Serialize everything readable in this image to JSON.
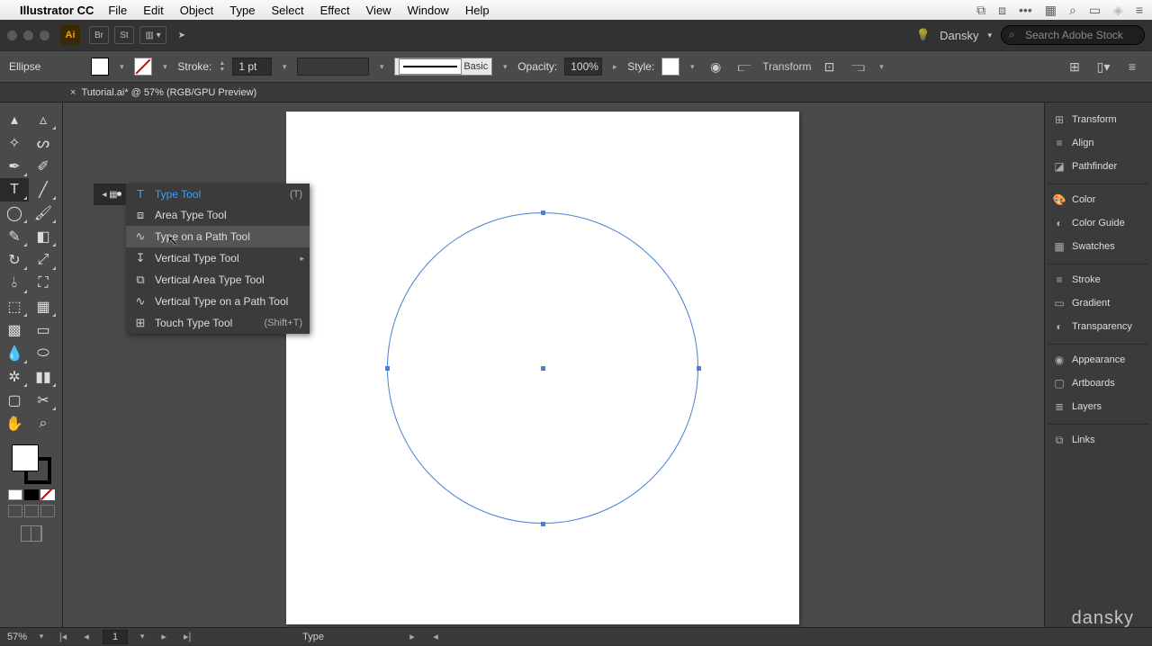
{
  "menubar": {
    "app": "Illustrator CC",
    "items": [
      "File",
      "Edit",
      "Object",
      "Type",
      "Select",
      "Effect",
      "View",
      "Window",
      "Help"
    ]
  },
  "app_top": {
    "user": "Dansky",
    "search_placeholder": "Search Adobe Stock"
  },
  "control_bar": {
    "selection_label": "Ellipse",
    "stroke_label": "Stroke:",
    "stroke_value": "1 pt",
    "brush_label": "Basic",
    "opacity_label": "Opacity:",
    "opacity_value": "100%",
    "style_label": "Style:",
    "transform_label": "Transform"
  },
  "tab": {
    "title": "Tutorial.ai* @ 57% (RGB/GPU Preview)"
  },
  "flyout": {
    "items": [
      {
        "label": "Type Tool",
        "shortcut": "(T)",
        "selected": true
      },
      {
        "label": "Area Type Tool"
      },
      {
        "label": "Type on a Path Tool",
        "hover": true
      },
      {
        "label": "Vertical Type Tool",
        "submenu": true
      },
      {
        "label": "Vertical Area Type Tool"
      },
      {
        "label": "Vertical Type on a Path Tool"
      },
      {
        "label": "Touch Type Tool",
        "shortcut": "(Shift+T)"
      }
    ]
  },
  "panels": {
    "groups": [
      [
        "Transform",
        "Align",
        "Pathfinder"
      ],
      [
        "Color",
        "Color Guide",
        "Swatches"
      ],
      [
        "Stroke",
        "Gradient",
        "Transparency"
      ],
      [
        "Appearance",
        "Artboards",
        "Layers"
      ],
      [
        "Links"
      ]
    ]
  },
  "status": {
    "zoom": "57%",
    "page": "1",
    "tool": "Type"
  },
  "watermark": "dansky"
}
